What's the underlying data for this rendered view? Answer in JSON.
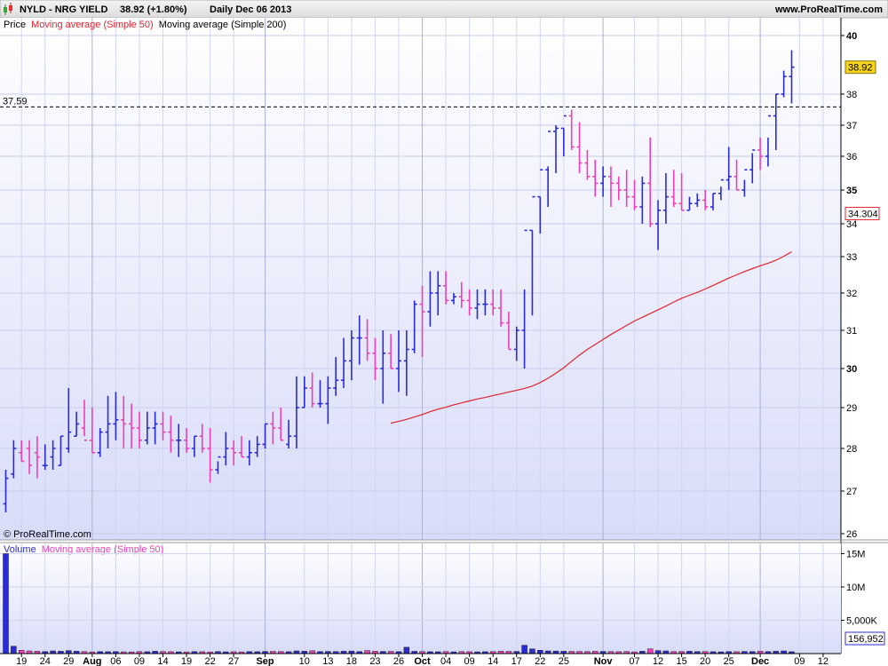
{
  "header": {
    "title": "NYLD - NRG YIELD",
    "last": "38.92 (+1.80%)",
    "info": "Daily  Dec 06 2013",
    "site": "www.ProRealTime.com"
  },
  "price_legend": {
    "price": "Price",
    "ma50": "Moving average (Simple 50)",
    "ma200": "Moving average (Simple 200)"
  },
  "volume_legend": {
    "volume": "Volume",
    "ma50": "Moving average (Simple 50)"
  },
  "watermark": "© ProRealTime.com",
  "colors": {
    "up": "#2b2bd6",
    "down": "#ee3fb6",
    "ma": "#e0242c",
    "last_badge": "#f5d21b",
    "ma_badge_text": "#e0242c"
  },
  "chart_data": {
    "type": "ohlc",
    "dates": [
      "Jul 17",
      "Jul 18",
      "Jul 19",
      "Jul 22",
      "Jul 23",
      "Jul 24",
      "Jul 25",
      "Jul 26",
      "Jul 29",
      "Jul 30",
      "Jul 31",
      "Aug 01",
      "Aug 02",
      "Aug 05",
      "Aug 06",
      "Aug 07",
      "Aug 08",
      "Aug 09",
      "Aug 12",
      "Aug 13",
      "Aug 14",
      "Aug 15",
      "Aug 16",
      "Aug 19",
      "Aug 20",
      "Aug 21",
      "Aug 22",
      "Aug 23",
      "Aug 26",
      "Aug 27",
      "Aug 28",
      "Aug 29",
      "Aug 30",
      "Sep 03",
      "Sep 04",
      "Sep 05",
      "Sep 06",
      "Sep 09",
      "Sep 10",
      "Sep 11",
      "Sep 12",
      "Sep 13",
      "Sep 16",
      "Sep 17",
      "Sep 18",
      "Sep 19",
      "Sep 20",
      "Sep 23",
      "Sep 24",
      "Sep 25",
      "Sep 26",
      "Sep 27",
      "Sep 30",
      "Oct 01",
      "Oct 02",
      "Oct 03",
      "Oct 04",
      "Oct 07",
      "Oct 08",
      "Oct 09",
      "Oct 10",
      "Oct 11",
      "Oct 14",
      "Oct 15",
      "Oct 16",
      "Oct 17",
      "Oct 18",
      "Oct 21",
      "Oct 22",
      "Oct 23",
      "Oct 24",
      "Oct 25",
      "Oct 28",
      "Oct 29",
      "Oct 30",
      "Oct 31",
      "Nov 01",
      "Nov 04",
      "Nov 05",
      "Nov 06",
      "Nov 07",
      "Nov 08",
      "Nov 11",
      "Nov 12",
      "Nov 13",
      "Nov 14",
      "Nov 15",
      "Nov 18",
      "Nov 19",
      "Nov 20",
      "Nov 21",
      "Nov 22",
      "Nov 25",
      "Nov 26",
      "Nov 27",
      "Nov 29",
      "Dec 02",
      "Dec 03",
      "Dec 04",
      "Dec 05",
      "Dec 06"
    ],
    "open": [
      26.7,
      27.4,
      27.9,
      28.0,
      27.9,
      27.6,
      27.8,
      27.6,
      28.0,
      28.3,
      28.5,
      28.2,
      27.9,
      28.4,
      28.6,
      28.7,
      28.6,
      28.5,
      28.2,
      28.5,
      28.6,
      28.4,
      28.2,
      28.2,
      28.0,
      28.3,
      28.0,
      27.5,
      27.8,
      28.0,
      27.9,
      27.8,
      27.9,
      28.1,
      28.6,
      28.5,
      28.1,
      28.3,
      29.0,
      29.5,
      29.1,
      29.1,
      29.5,
      29.7,
      30.2,
      30.8,
      30.8,
      30.4,
      30.0,
      30.4,
      30.0,
      30.2,
      30.5,
      31.7,
      31.5,
      32.0,
      32.2,
      31.8,
      31.9,
      31.8,
      31.6,
      31.7,
      31.7,
      31.6,
      31.2,
      30.5,
      31.0,
      33.8,
      34.8,
      35.6,
      36.8,
      36.9,
      37.3,
      36.3,
      35.8,
      35.4,
      35.2,
      35.4,
      35.2,
      35.0,
      34.8,
      34.5,
      35.2,
      34.0,
      34.4,
      34.8,
      34.6,
      34.4,
      34.6,
      34.7,
      34.5,
      34.9,
      35.3,
      35.4,
      35.0,
      35.6,
      36.2,
      36.0,
      37.3,
      38.0,
      38.6
    ],
    "high": [
      27.5,
      28.2,
      28.2,
      28.2,
      28.3,
      28.1,
      28.2,
      28.3,
      29.5,
      28.9,
      29.2,
      29.0,
      28.5,
      29.3,
      29.4,
      29.3,
      29.1,
      28.9,
      28.9,
      28.9,
      28.9,
      28.8,
      28.6,
      28.5,
      28.3,
      28.6,
      28.5,
      27.7,
      28.4,
      28.2,
      28.3,
      28.2,
      28.3,
      28.6,
      28.9,
      29.0,
      28.7,
      29.8,
      29.8,
      29.9,
      29.7,
      29.8,
      30.3,
      30.8,
      31.0,
      31.4,
      31.3,
      30.8,
      31.0,
      30.9,
      31.0,
      31.0,
      31.8,
      32.2,
      32.6,
      32.6,
      32.6,
      32.0,
      32.3,
      32.1,
      32.1,
      32.1,
      32.1,
      32.1,
      31.5,
      31.1,
      32.1,
      33.8,
      34.8,
      35.7,
      37.0,
      36.9,
      37.5,
      37.1,
      36.2,
      35.9,
      35.7,
      35.7,
      35.4,
      35.6,
      35.3,
      35.4,
      36.6,
      34.7,
      35.5,
      35.6,
      35.5,
      34.8,
      34.9,
      35.0,
      34.9,
      35.1,
      36.3,
      35.9,
      35.3,
      36.1,
      36.6,
      36.6,
      38.0,
      38.8,
      39.5
    ],
    "low": [
      26.5,
      27.3,
      27.7,
      27.4,
      27.3,
      27.5,
      27.5,
      27.6,
      27.9,
      28.3,
      28.3,
      27.9,
      27.8,
      28.0,
      28.2,
      28.0,
      28.0,
      28.0,
      28.1,
      28.1,
      28.2,
      27.9,
      27.8,
      27.9,
      27.8,
      27.9,
      27.2,
      27.4,
      27.6,
      27.6,
      27.8,
      27.6,
      27.8,
      28.0,
      28.1,
      28.2,
      28.0,
      28.0,
      29.0,
      29.0,
      29.0,
      28.6,
      29.3,
      29.5,
      29.7,
      30.1,
      30.2,
      29.7,
      29.1,
      30.0,
      29.4,
      29.3,
      30.4,
      30.3,
      31.1,
      31.4,
      31.7,
      31.7,
      31.6,
      31.4,
      31.3,
      31.4,
      31.4,
      31.1,
      30.5,
      30.2,
      30.0,
      31.4,
      33.7,
      34.5,
      35.5,
      36.0,
      36.2,
      35.5,
      35.3,
      34.8,
      34.8,
      34.5,
      34.7,
      34.5,
      34.4,
      34.0,
      33.9,
      33.2,
      34.0,
      34.5,
      34.4,
      34.4,
      34.5,
      34.4,
      34.4,
      34.7,
      35.0,
      35.0,
      34.8,
      35.2,
      35.6,
      35.7,
      36.2,
      37.9,
      37.7
    ],
    "close": [
      27.3,
      28.0,
      27.7,
      27.6,
      27.8,
      27.6,
      28.0,
      28.3,
      28.4,
      28.6,
      28.2,
      27.9,
      28.4,
      28.6,
      28.7,
      28.6,
      28.5,
      28.2,
      28.5,
      28.6,
      28.4,
      28.2,
      28.2,
      28.0,
      28.3,
      28.0,
      27.5,
      27.8,
      28.0,
      27.9,
      27.8,
      27.9,
      28.1,
      28.6,
      28.5,
      28.2,
      28.3,
      29.0,
      29.5,
      29.1,
      29.1,
      29.5,
      29.7,
      30.2,
      30.8,
      30.8,
      30.4,
      30.0,
      30.4,
      30.0,
      30.2,
      30.5,
      31.7,
      31.5,
      32.0,
      32.2,
      31.8,
      31.9,
      31.8,
      31.6,
      31.7,
      31.7,
      31.6,
      31.2,
      30.5,
      31.0,
      33.8,
      34.8,
      35.6,
      36.8,
      36.9,
      37.3,
      36.3,
      35.8,
      35.4,
      35.2,
      35.4,
      35.2,
      35.0,
      34.8,
      34.5,
      35.2,
      34.0,
      34.4,
      34.8,
      34.6,
      34.4,
      34.6,
      34.7,
      34.5,
      34.9,
      35.3,
      35.4,
      35.0,
      35.6,
      36.2,
      36.0,
      37.3,
      38.0,
      38.6,
      38.92
    ],
    "ma50_start_index": 49,
    "ma50": [
      28.62,
      28.66,
      28.71,
      28.77,
      28.83,
      28.9,
      28.96,
      29.01,
      29.07,
      29.12,
      29.17,
      29.22,
      29.26,
      29.31,
      29.35,
      29.4,
      29.44,
      29.49,
      29.55,
      29.64,
      29.75,
      29.88,
      30.02,
      30.19,
      30.35,
      30.5,
      30.63,
      30.76,
      30.89,
      31.01,
      31.13,
      31.25,
      31.35,
      31.45,
      31.55,
      31.65,
      31.76,
      31.86,
      31.94,
      32.02,
      32.11,
      32.21,
      32.31,
      32.41,
      32.5,
      32.59,
      32.67,
      32.75,
      32.82,
      32.9,
      33.01,
      33.15
    ],
    "volume_k": [
      15000,
      1100,
      500,
      400,
      350,
      300,
      400,
      350,
      450,
      350,
      300,
      250,
      300,
      280,
      300,
      260,
      250,
      300,
      280,
      350,
      300,
      280,
      260,
      250,
      300,
      280,
      250,
      300,
      260,
      280,
      250,
      300,
      280,
      320,
      330,
      300,
      280,
      400,
      350,
      420,
      300,
      320,
      300,
      350,
      380,
      300,
      450,
      350,
      320,
      330,
      300,
      950,
      340,
      300,
      280,
      270,
      300,
      260,
      300,
      280,
      260,
      280,
      300,
      350,
      330,
      320,
      1250,
      700,
      500,
      400,
      380,
      350,
      330,
      320,
      300,
      340,
      320,
      300,
      280,
      300,
      260,
      350,
      700,
      450,
      400,
      300,
      300,
      350,
      300,
      300,
      280,
      260,
      300,
      280,
      320,
      300,
      350,
      300,
      350,
      400,
      280
    ],
    "y_ticks": [
      26,
      27,
      28,
      29,
      30,
      31,
      32,
      33,
      34,
      35,
      36,
      37,
      38,
      40
    ],
    "y_range": [
      25.9,
      40.4
    ],
    "vol_ticks": [
      "15M",
      "10M",
      "5,000K"
    ],
    "vol_max_k": 16000,
    "reference_line": "37.59",
    "last_value": "38.92",
    "ma50_last": "34.304",
    "volume_last": "156,952",
    "x_labels": [
      {
        "text": "19",
        "i": 2,
        "bold": false
      },
      {
        "text": "24",
        "i": 5,
        "bold": false
      },
      {
        "text": "29",
        "i": 8,
        "bold": false
      },
      {
        "text": "Aug",
        "i": 11,
        "bold": true
      },
      {
        "text": "06",
        "i": 14,
        "bold": false
      },
      {
        "text": "09",
        "i": 17,
        "bold": false
      },
      {
        "text": "14",
        "i": 20,
        "bold": false
      },
      {
        "text": "19",
        "i": 23,
        "bold": false
      },
      {
        "text": "22",
        "i": 26,
        "bold": false
      },
      {
        "text": "27",
        "i": 29,
        "bold": false
      },
      {
        "text": "Sep",
        "i": 33,
        "bold": true
      },
      {
        "text": "10",
        "i": 38,
        "bold": false
      },
      {
        "text": "13",
        "i": 41,
        "bold": false
      },
      {
        "text": "18",
        "i": 44,
        "bold": false
      },
      {
        "text": "23",
        "i": 47,
        "bold": false
      },
      {
        "text": "26",
        "i": 50,
        "bold": false
      },
      {
        "text": "Oct",
        "i": 53,
        "bold": true
      },
      {
        "text": "04",
        "i": 56,
        "bold": false
      },
      {
        "text": "09",
        "i": 59,
        "bold": false
      },
      {
        "text": "14",
        "i": 62,
        "bold": false
      },
      {
        "text": "17",
        "i": 65,
        "bold": false
      },
      {
        "text": "22",
        "i": 68,
        "bold": false
      },
      {
        "text": "25",
        "i": 71,
        "bold": false
      },
      {
        "text": "Nov",
        "i": 76,
        "bold": true
      },
      {
        "text": "07",
        "i": 80,
        "bold": false
      },
      {
        "text": "12",
        "i": 83,
        "bold": false
      },
      {
        "text": "15",
        "i": 86,
        "bold": false
      },
      {
        "text": "20",
        "i": 89,
        "bold": false
      },
      {
        "text": "25",
        "i": 92,
        "bold": false
      },
      {
        "text": "Dec",
        "i": 96,
        "bold": true
      },
      {
        "text": "09",
        "i": 101,
        "bold": false
      },
      {
        "text": "12",
        "i": 104,
        "bold": false
      }
    ]
  }
}
